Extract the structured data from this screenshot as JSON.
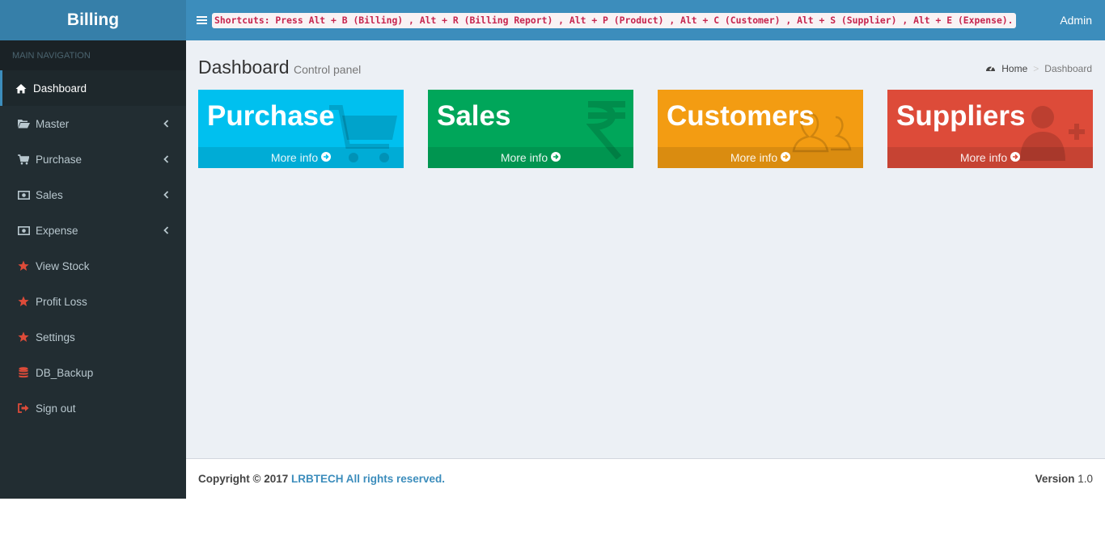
{
  "app": {
    "title": "Billing"
  },
  "topbar": {
    "shortcuts": "Shortcuts: Press Alt + B (Billing) , Alt + R (Billing Report) , Alt + P (Product) , Alt + C (Customer) , Alt + S (Supplier) , Alt + E (Expense).",
    "user": "Admin"
  },
  "sidebar": {
    "header": "MAIN NAVIGATION",
    "items": [
      {
        "label": "Dashboard",
        "icon": "home-icon",
        "active": true
      },
      {
        "label": "Master",
        "icon": "folder-open-icon",
        "has_children": true
      },
      {
        "label": "Purchase",
        "icon": "cart-icon",
        "has_children": true
      },
      {
        "label": "Sales",
        "icon": "money-icon",
        "has_children": true
      },
      {
        "label": "Expense",
        "icon": "money-icon",
        "has_children": true
      },
      {
        "label": "View Stock",
        "icon": "star-icon"
      },
      {
        "label": "Profit Loss",
        "icon": "star-icon"
      },
      {
        "label": "Settings",
        "icon": "star-icon"
      },
      {
        "label": "DB_Backup",
        "icon": "database-icon"
      },
      {
        "label": "Sign out",
        "icon": "sign-out-icon"
      }
    ]
  },
  "page": {
    "title": "Dashboard",
    "subtitle": "Control panel",
    "breadcrumb": {
      "home": "Home",
      "current": "Dashboard"
    }
  },
  "boxes": [
    {
      "title": "Purchase",
      "link": "More info",
      "color": "#00c0ef",
      "icon": "cart-icon"
    },
    {
      "title": "Sales",
      "link": "More info",
      "color": "#00a65a",
      "icon": "rupee-icon"
    },
    {
      "title": "Customers",
      "link": "More info",
      "color": "#f39c12",
      "icon": "users-icon"
    },
    {
      "title": "Suppliers",
      "link": "More info",
      "color": "#dd4b39",
      "icon": "user-plus-icon"
    }
  ],
  "footer": {
    "copyright_prefix": "Copyright © 2017 ",
    "company": "LRBTECH All rights reserved.",
    "version_label": "Version",
    "version_value": "1.0"
  },
  "colors": {
    "brand": "#3c8dbc",
    "brand_dark": "#367fa9",
    "sidebar_bg": "#222d32",
    "content_bg": "#ecf0f5",
    "star": "#dd4b39"
  }
}
